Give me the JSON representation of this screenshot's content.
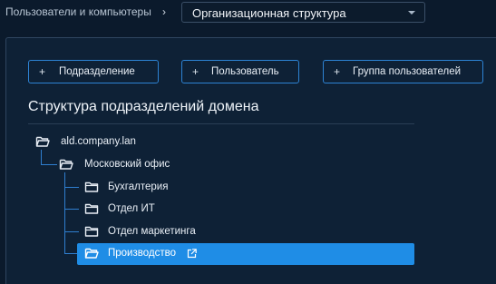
{
  "header": {
    "breadcrumb": "Пользователи и компьютеры",
    "separator": "›",
    "view_select": {
      "value": "Организационная структура"
    }
  },
  "toolbar": {
    "add_subdivision": "Подразделение",
    "add_user": "Пользователь",
    "add_user_group": "Группа пользователей",
    "plus_glyph": "+"
  },
  "section": {
    "title": "Структура подразделений домена"
  },
  "tree": {
    "root": {
      "label": "ald.company.lan",
      "icon": "folder-open-icon"
    },
    "office": {
      "label": "Московский офис",
      "icon": "folder-open-icon"
    },
    "children": [
      {
        "label": "Бухгалтерия",
        "icon": "folder-icon"
      },
      {
        "label": "Отдел ИТ",
        "icon": "folder-icon"
      },
      {
        "label": "Отдел маркетинга",
        "icon": "folder-icon"
      },
      {
        "label": "Производство",
        "icon": "folder-open-icon",
        "selected": true
      }
    ]
  },
  "colors": {
    "background": "#0b1a2c",
    "panel": "#0e2136",
    "accent": "#2d83d4",
    "selected": "#1f8de6"
  }
}
